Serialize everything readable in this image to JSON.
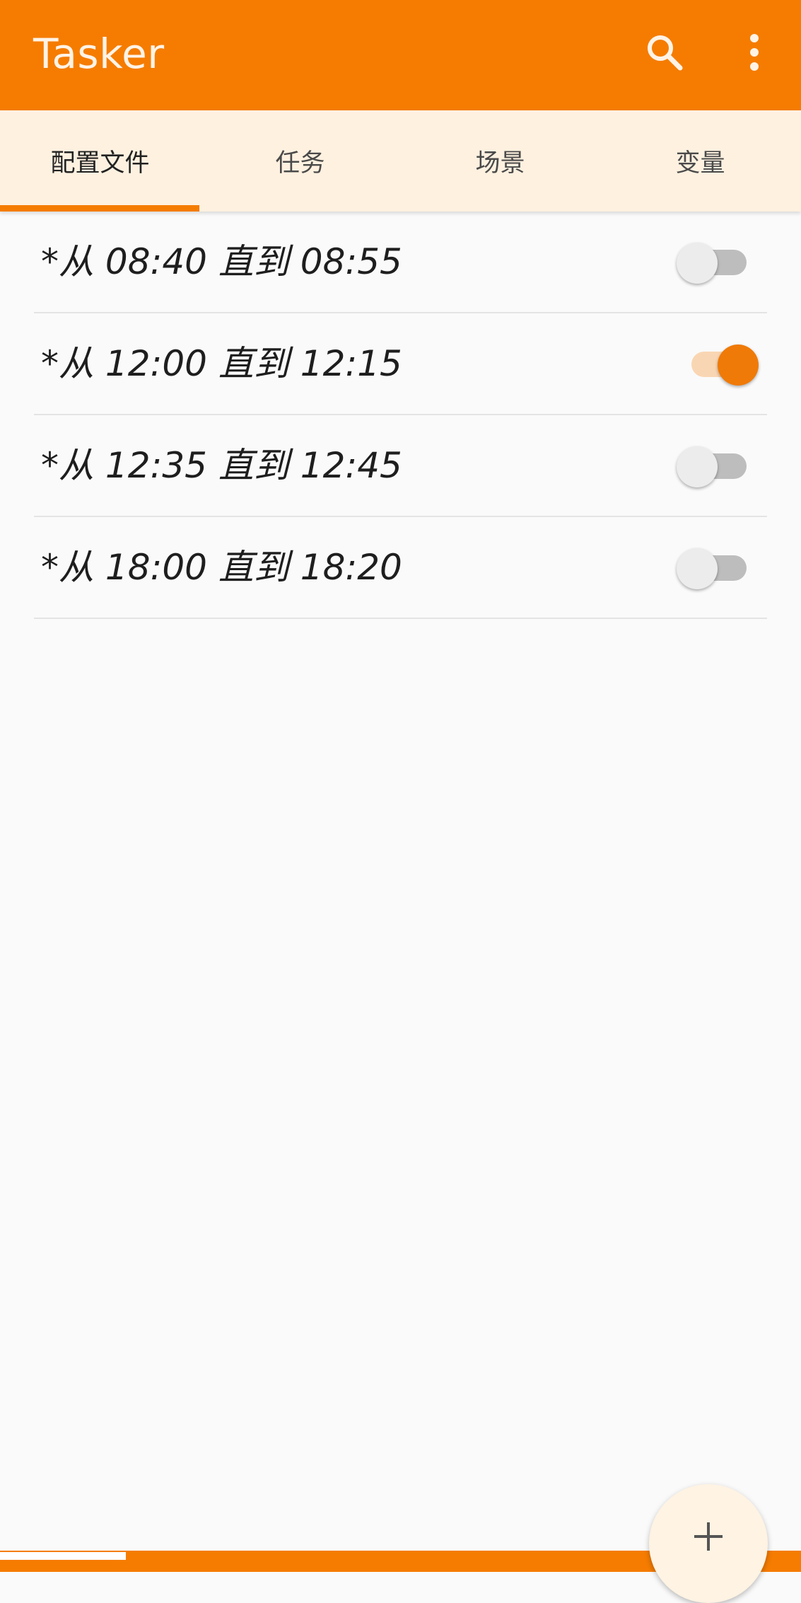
{
  "appbar": {
    "title": "Tasker",
    "search_icon": "search-icon",
    "overflow_icon": "more-vert-icon",
    "color": "#f57c00"
  },
  "tabs": [
    {
      "label": "配置文件",
      "selected": true
    },
    {
      "label": "任务",
      "selected": false
    },
    {
      "label": "场景",
      "selected": false
    },
    {
      "label": "变量",
      "selected": false
    }
  ],
  "profiles": [
    {
      "name": "*从 08:40 直到 08:55",
      "enabled": false
    },
    {
      "name": "*从 12:00 直到 12:15",
      "enabled": true
    },
    {
      "name": "*从 12:35 直到 12:45",
      "enabled": false
    },
    {
      "name": "*从 18:00 直到 18:20",
      "enabled": false
    }
  ],
  "fab": {
    "icon": "plus-icon"
  },
  "colors": {
    "accent": "#f57c00",
    "tab_background": "#fff1e0",
    "switch_on_thumb": "#ef7a08",
    "switch_on_track": "#f9d6b3",
    "switch_off_thumb": "#ececec",
    "switch_off_track": "#bdbdbd"
  }
}
